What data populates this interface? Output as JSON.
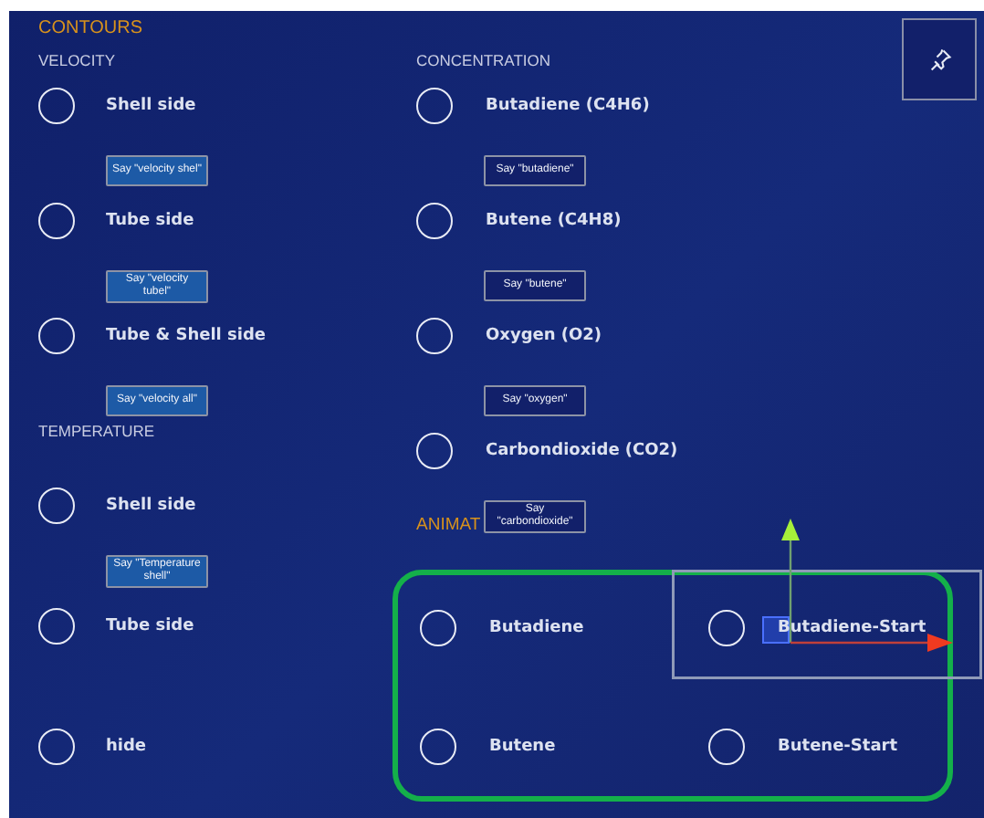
{
  "contours": {
    "title": "CONTOURS"
  },
  "velocity": {
    "title": "VELOCITY",
    "options": [
      {
        "label": "Shell side",
        "selected": false,
        "say": {
          "text": "Say \"velocity shel\"",
          "kind": "filled"
        }
      },
      {
        "label": "Tube side",
        "selected": false,
        "say": {
          "text": "Say \"velocity tubel\"",
          "kind": "filled"
        }
      },
      {
        "label": "Tube & Shell side",
        "selected": false,
        "say": {
          "text": "Say \"velocity all\"",
          "kind": "filled"
        }
      }
    ]
  },
  "temperature": {
    "title": "TEMPERATURE",
    "options": [
      {
        "label": "Shell side",
        "selected": false,
        "say": {
          "text": "Say \"Temperature shell\"",
          "kind": "filled"
        }
      },
      {
        "label": "Tube side",
        "selected": false
      },
      {
        "label": "hide",
        "selected": false
      }
    ]
  },
  "concentration": {
    "title": "CONCENTRATION",
    "options": [
      {
        "label": "Butadiene (C4H6)",
        "selected": false,
        "say": {
          "text": "Say \"butadiene\"",
          "kind": "outline"
        }
      },
      {
        "label": "Butene (C4H8)",
        "selected": false,
        "say": {
          "text": "Say \"butene\"",
          "kind": "outline"
        }
      },
      {
        "label": "Oxygen (O2)",
        "selected": false,
        "say": {
          "text": "Say \"oxygen\"",
          "kind": "outline"
        }
      },
      {
        "label": "Carbondioxide (CO2)",
        "selected": false,
        "say": {
          "text": "Say \"carbondioxide\"",
          "kind": "outline"
        }
      }
    ]
  },
  "animation": {
    "title": "ANIMAT",
    "options": [
      {
        "label": "Butadiene",
        "selected": false,
        "gizmo_attached": false
      },
      {
        "label": "Butadiene-Start",
        "selected": false,
        "gizmo_attached": true
      },
      {
        "label": "Butene",
        "selected": false,
        "gizmo_attached": false
      },
      {
        "label": "Butene-Start",
        "selected": false,
        "gizmo_attached": false
      }
    ]
  }
}
